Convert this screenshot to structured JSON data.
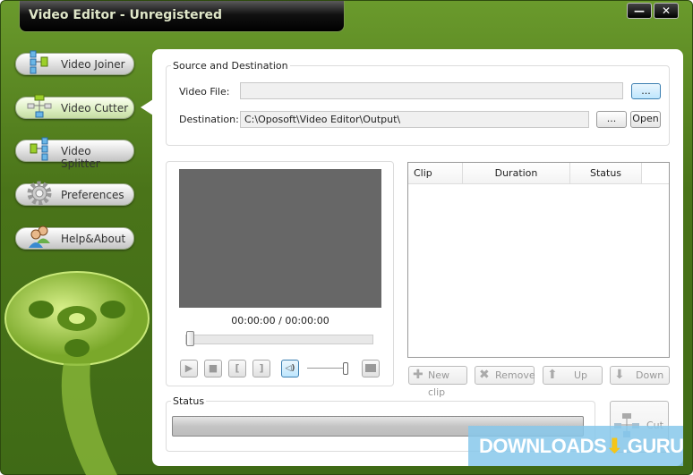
{
  "window": {
    "title": "Video Editor - Unregistered",
    "minimize": "—",
    "close": "✕"
  },
  "sidebar": {
    "items": [
      {
        "label": "Video Joiner"
      },
      {
        "label": "Video Cutter"
      },
      {
        "label": "Video Splitter"
      },
      {
        "label": "Preferences"
      },
      {
        "label": "Help&About"
      }
    ]
  },
  "source": {
    "group_label": "Source and Destination",
    "video_file_label": "Video File:",
    "video_file_value": "",
    "browse_label": "...",
    "destination_label": "Destination:",
    "destination_value": "C:\\Oposoft\\Video Editor\\Output\\",
    "dest_browse_label": "...",
    "open_label": "Open"
  },
  "player": {
    "time": "00:00:00 / 00:00:00",
    "seek_fraction": 0,
    "volume_fraction": 1,
    "controls": {
      "play": "▶",
      "stop": "■",
      "mark_in": "[",
      "mark_out": "]"
    }
  },
  "clips": {
    "columns": [
      "Clip",
      "Duration",
      "Status"
    ],
    "rows": [],
    "new_clip": "New clip",
    "remove": "Remove",
    "up": "Up",
    "down": "Down"
  },
  "status": {
    "group_label": "Status",
    "progress": 0
  },
  "cut_label": "Cut",
  "watermark": {
    "left": "DOWNLOADS",
    "right": ".GURU"
  }
}
